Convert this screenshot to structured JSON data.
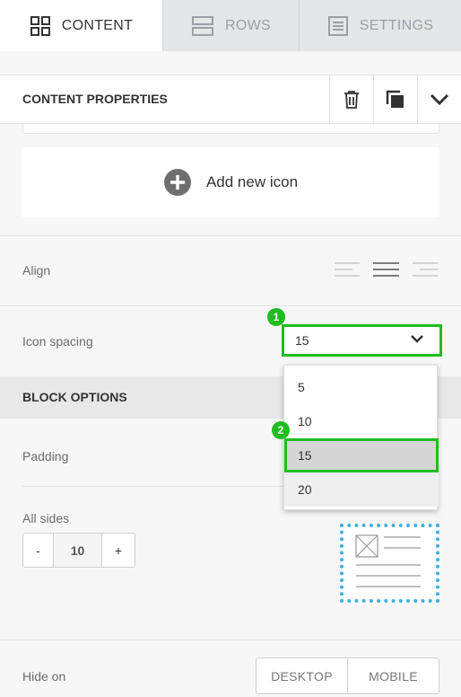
{
  "tabs": [
    {
      "label": "CONTENT",
      "icon": "grid-icon",
      "active": true
    },
    {
      "label": "ROWS",
      "icon": "rows-icon",
      "active": false
    },
    {
      "label": "SETTINGS",
      "icon": "settings-doc-icon",
      "active": false
    }
  ],
  "header": {
    "title": "CONTENT PROPERTIES"
  },
  "add_icon": {
    "label": "Add new icon"
  },
  "align": {
    "label": "Align"
  },
  "icon_spacing": {
    "label": "Icon spacing",
    "value": "15"
  },
  "dropdown": {
    "options": [
      "5",
      "10",
      "15",
      "20"
    ],
    "highlighted": "15"
  },
  "badges": [
    "1",
    "2"
  ],
  "block_options": {
    "title": "BLOCK OPTIONS"
  },
  "padding": {
    "label": "Padding",
    "sub_label": "All sides",
    "value": "10",
    "minus": "-",
    "plus": "+"
  },
  "hide_on": {
    "label": "Hide on",
    "desktop": "DESKTOP",
    "mobile": "MOBILE"
  },
  "colors": {
    "accent_green": "#1fbd1f",
    "preview_border": "#3fb0e0",
    "tab_inactive": "#e4e6e8"
  }
}
